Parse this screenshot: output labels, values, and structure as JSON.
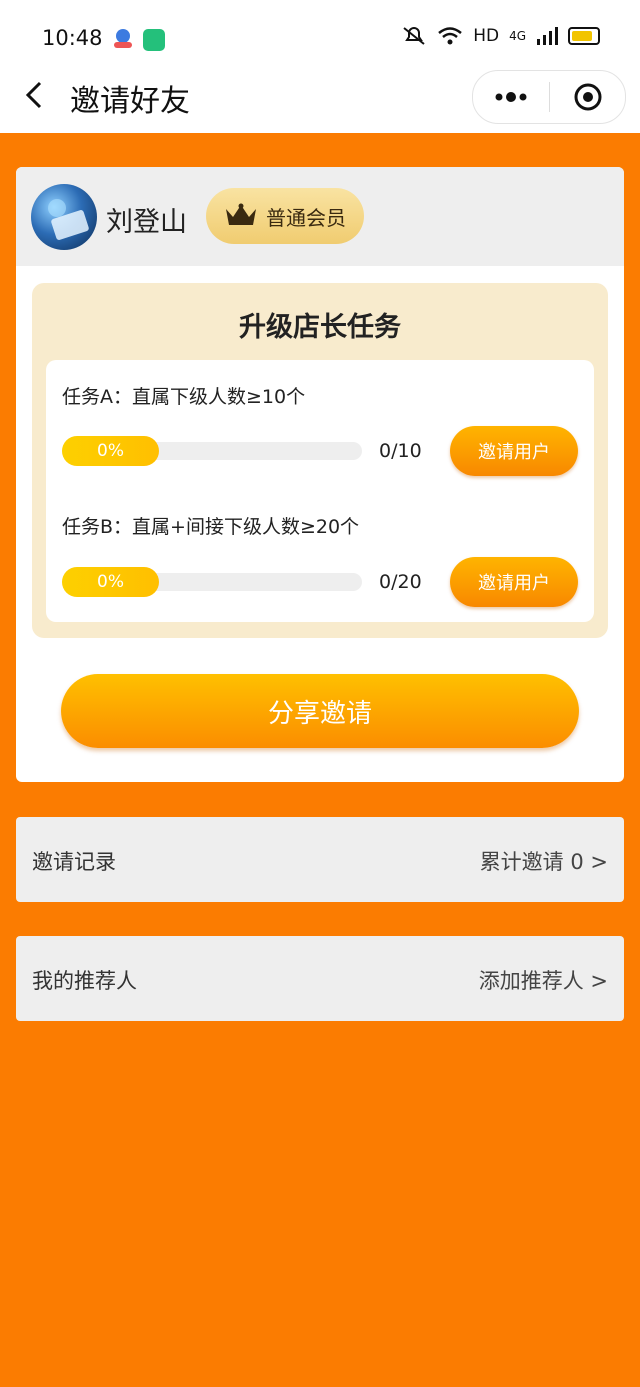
{
  "status": {
    "time": "10:48",
    "network": "HD",
    "signal": "4G"
  },
  "nav": {
    "title": "邀请好友",
    "back_icon": "chevron-left-icon",
    "more_icon": "more-dots-icon",
    "close_icon": "target-circle-icon"
  },
  "user": {
    "name": "刘登山",
    "member_level": "普通会员"
  },
  "tasks": {
    "title": "升级店长任务",
    "items": [
      {
        "label": "任务A：直属下级人数≥10个",
        "percent": "0%",
        "count": "0/10",
        "button": "邀请用户",
        "progress": 0
      },
      {
        "label": "任务B：直属+间接下级人数≥20个",
        "percent": "0%",
        "count": "0/20",
        "button": "邀请用户",
        "progress": 0
      }
    ]
  },
  "share_button": "分享邀请",
  "invite_record": {
    "label": "邀请记录",
    "value": "累计邀请 0 >"
  },
  "referrer": {
    "label": "我的推荐人",
    "value": "添加推荐人 >"
  },
  "colors": {
    "background": "#fb7c01",
    "accent": "#ffb400",
    "progress": "#fdd000"
  }
}
